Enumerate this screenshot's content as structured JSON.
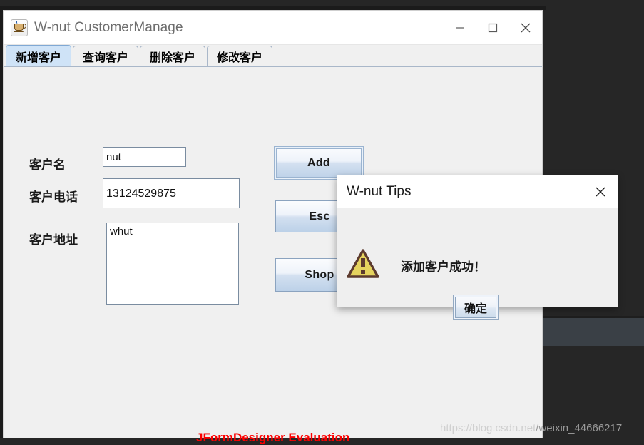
{
  "window": {
    "title": "W-nut CustomerManage",
    "icon": "java-coffee-cup-icon",
    "controls": {
      "minimize": "minimize-icon",
      "maximize": "maximize-icon",
      "close": "close-icon"
    }
  },
  "tabs": [
    {
      "label": "新增客户",
      "selected": true
    },
    {
      "label": "查询客户",
      "selected": false
    },
    {
      "label": "删除客户",
      "selected": false
    },
    {
      "label": "修改客户",
      "selected": false
    }
  ],
  "form": {
    "fields": [
      {
        "label": "客户名",
        "value": "nut",
        "placeholder": ""
      },
      {
        "label": "客户电话",
        "value": "13124529875",
        "placeholder": ""
      },
      {
        "label": "客户地址",
        "value": "whut",
        "placeholder": ""
      }
    ]
  },
  "buttons": [
    {
      "label": "Add",
      "focused": true
    },
    {
      "label": "Esc",
      "focused": false
    },
    {
      "label": "Shop",
      "focused": false
    }
  ],
  "footer": {
    "evaluation_notice": "JFormDesigner Evaluation",
    "evaluation_color": "#fb0000"
  },
  "dialog": {
    "title": "W-nut Tips",
    "close_icon": "close-icon",
    "icon": "warning-triangle-icon",
    "message": "添加客户成功！",
    "ok_label": "确定"
  },
  "watermark": {
    "prefix": "https://blog.csdn.net",
    "suffix": "/weixin_44666217"
  },
  "colors": {
    "desktop": "#262626",
    "band": "#3a4046",
    "panel": "#f0f0f0",
    "tab_selected": "#cfe3f7",
    "warning_fill": "#e5d35e",
    "warning_stroke": "#5c3a2e"
  }
}
